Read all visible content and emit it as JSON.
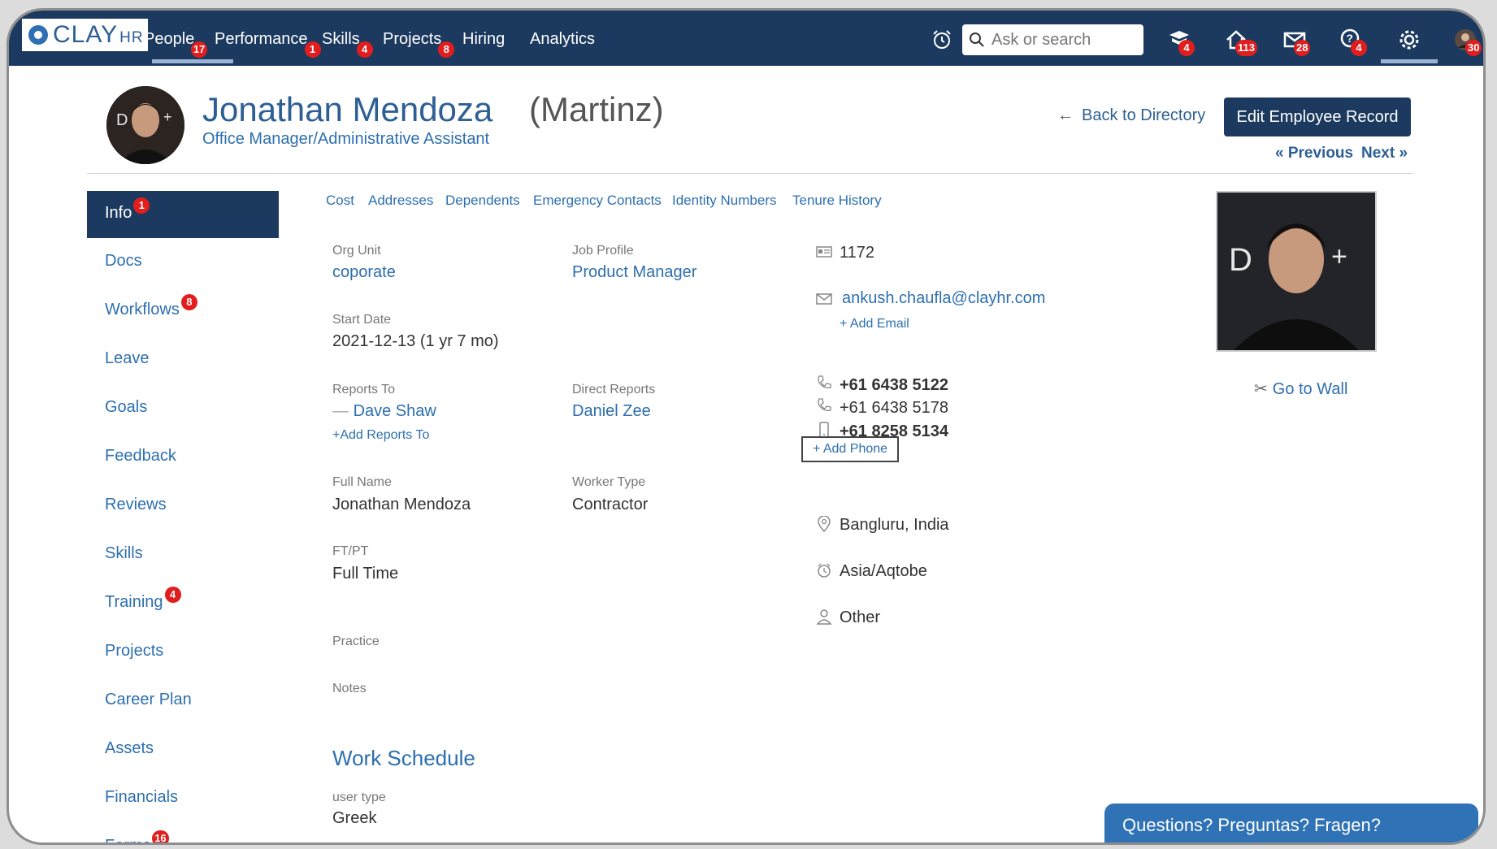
{
  "nav": {
    "logo_text": "CLAY",
    "logo_suffix": "HR",
    "items": [
      {
        "label": "People",
        "badge": "17"
      },
      {
        "label": "Performance",
        "badge": "1"
      },
      {
        "label": "Skills",
        "badge": "4"
      },
      {
        "label": "Projects",
        "badge": "8"
      },
      {
        "label": "Hiring",
        "badge": ""
      },
      {
        "label": "Analytics",
        "badge": ""
      }
    ],
    "search_placeholder": "Ask or search",
    "icon_badges": {
      "courses": "4",
      "home": "113",
      "mail": "28",
      "help": "4",
      "profile": "30"
    }
  },
  "header": {
    "name": "Jonathan Mendoza",
    "nickname": "(Martinz)",
    "job_title": "Office Manager/Administrative Assistant",
    "back_label": "Back to Directory",
    "edit_label": "Edit Employee Record",
    "previous_label": "« Previous",
    "next_label": "Next »"
  },
  "sidebar": {
    "items": [
      {
        "label": "Info",
        "badge": "1"
      },
      {
        "label": "Docs",
        "badge": ""
      },
      {
        "label": "Workflows",
        "badge": "8"
      },
      {
        "label": "Leave",
        "badge": ""
      },
      {
        "label": "Goals",
        "badge": ""
      },
      {
        "label": "Feedback",
        "badge": ""
      },
      {
        "label": "Reviews",
        "badge": ""
      },
      {
        "label": "Skills",
        "badge": ""
      },
      {
        "label": "Training",
        "badge": "4"
      },
      {
        "label": "Projects",
        "badge": ""
      },
      {
        "label": "Career Plan",
        "badge": ""
      },
      {
        "label": "Assets",
        "badge": ""
      },
      {
        "label": "Financials",
        "badge": ""
      },
      {
        "label": "Forms",
        "badge": "16"
      }
    ]
  },
  "subtabs": [
    "Cost",
    "Addresses",
    "Dependents",
    "Emergency Contacts",
    "Identity Numbers",
    "Tenure History"
  ],
  "fields": {
    "org_unit_label": "Org Unit",
    "org_unit": "coporate",
    "job_profile_label": "Job Profile",
    "job_profile": "Product Manager",
    "start_date_label": "Start Date",
    "start_date": "2021-12-13 (1 yr 7 mo)",
    "reports_to_label": "Reports To",
    "reports_to": "Dave Shaw",
    "add_reports_to": "+Add Reports To",
    "direct_reports_label": "Direct Reports",
    "direct_reports": "Daniel Zee",
    "full_name_label": "Full Name",
    "full_name": "Jonathan Mendoza",
    "worker_type_label": "Worker Type",
    "worker_type": "Contractor",
    "ftpt_label": "FT/PT",
    "ftpt": "Full Time",
    "practice_label": "Practice",
    "notes_label": "Notes"
  },
  "contact": {
    "employee_id": "1172",
    "email": "ankush.chaufla@clayhr.com",
    "add_email": "+ Add Email",
    "phones": [
      "+61 6438 5122",
      "+61 6438 5178",
      "+61 8258 5134"
    ],
    "add_phone": "+ Add Phone",
    "location": "Bangluru, India",
    "timezone": "Asia/Aqtobe",
    "gender": "Other"
  },
  "wall_label": "Go to Wall",
  "work_schedule": {
    "title": "Work Schedule",
    "user_type_label": "user type",
    "user_type": "Greek"
  },
  "help_label": "Questions? Preguntas? Fragen?"
}
